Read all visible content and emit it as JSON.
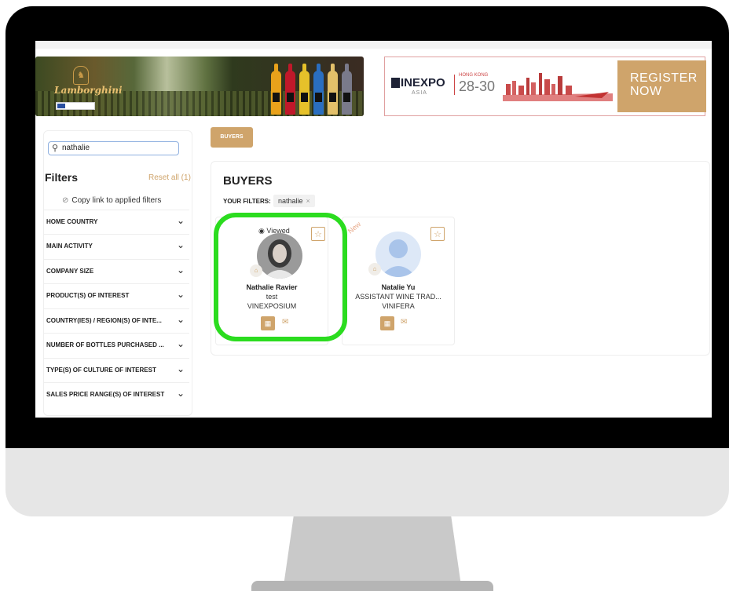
{
  "banner_left": {
    "logo_text": "Lamborghini"
  },
  "banner_right": {
    "brand": "INEXPO",
    "sub": "ASIA",
    "place": "HONG KONG",
    "dates": "28-30",
    "cta": "REGISTER NOW"
  },
  "sidebar": {
    "search_value": "nathalie",
    "filters_title": "Filters",
    "reset_label": "Reset all (1)",
    "copy_link": "Copy link to applied filters",
    "filters": [
      {
        "label": "HOME COUNTRY"
      },
      {
        "label": "MAIN ACTIVITY"
      },
      {
        "label": "COMPANY SIZE"
      },
      {
        "label": "PRODUCT(S) OF INTEREST"
      },
      {
        "label": "COUNTRY(IES) / REGION(S) OF INTE..."
      },
      {
        "label": "NUMBER OF BOTTLES PURCHASED ..."
      },
      {
        "label": "TYPE(S) OF CULTURE OF INTEREST"
      },
      {
        "label": "SALES PRICE RANGE(S) OF INTEREST"
      }
    ]
  },
  "main": {
    "tab_label": "BUYERS",
    "title": "BUYERS",
    "your_filters_label": "YOUR FILTERS:",
    "chip_label": "nathalie",
    "chip_remove": "×",
    "cards": [
      {
        "viewed": "Viewed",
        "name": "Nathalie Ravier",
        "role": "test",
        "company": "VINEXPOSIUM",
        "highlighted": true
      },
      {
        "new_tag": "New",
        "name": "Natalie Yu",
        "role": "ASSISTANT WINE TRAD...",
        "company": "VINIFERA"
      }
    ]
  },
  "colors": {
    "accent": "#cfa46b",
    "highlight": "#2bdc1f"
  }
}
